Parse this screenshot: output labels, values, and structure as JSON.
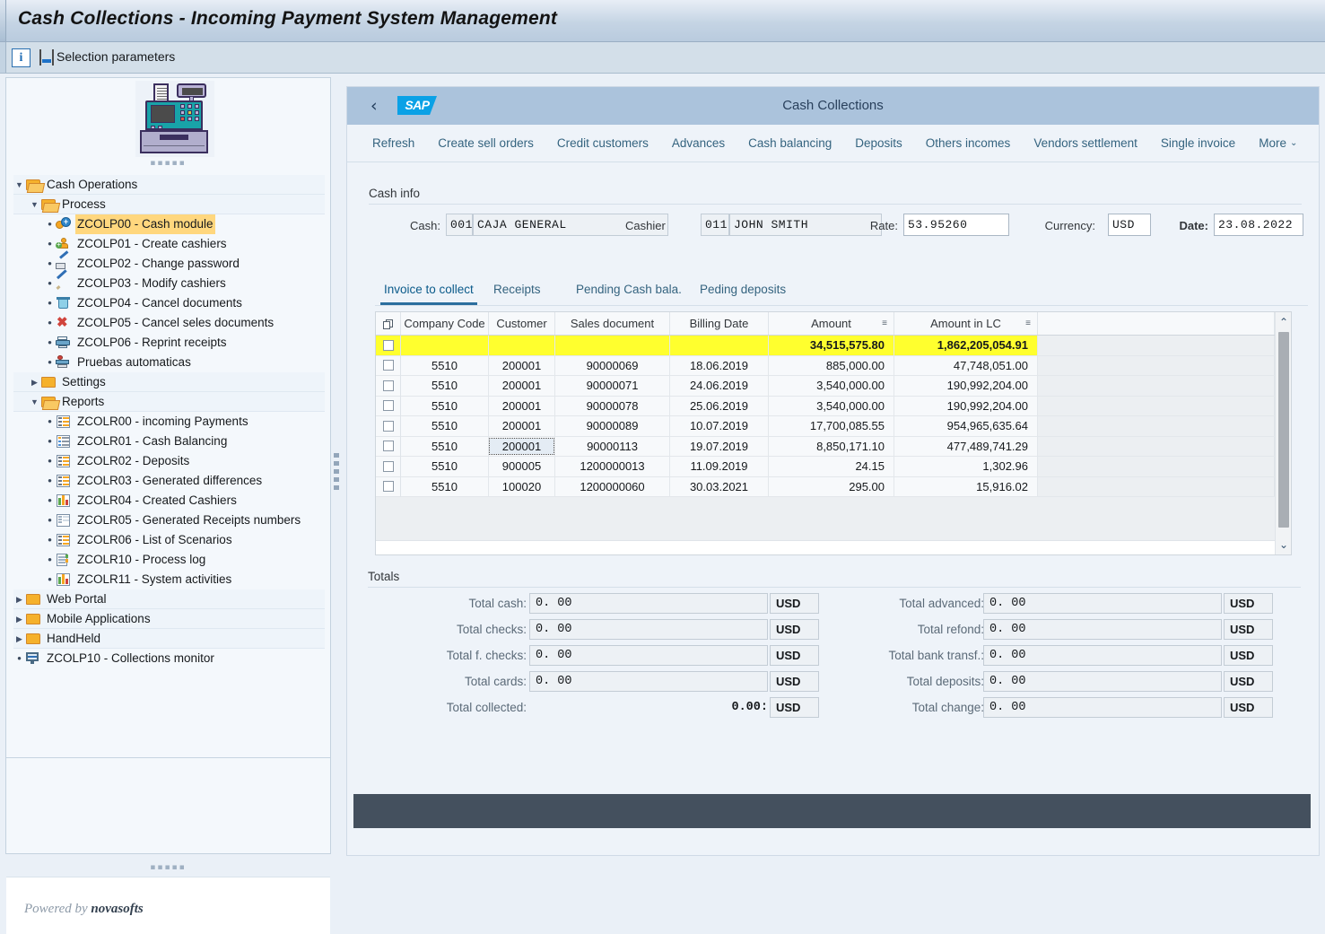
{
  "window": {
    "title": "Cash Collections - Incoming Payment System Management"
  },
  "toolbar": {
    "info_icon": "info-icon",
    "params_icon": "selection-parameters-icon",
    "selection_parameters_label": "Selection parameters"
  },
  "sidebar": {
    "logo_alt": "cash-register-image",
    "powered_prefix": "Powered by ",
    "powered_brand": "novasofts",
    "tree": [
      {
        "label": "Cash Operations",
        "level": 0,
        "kind": "folder-open",
        "expanded": true
      },
      {
        "label": "Process",
        "level": 1,
        "kind": "folder-open",
        "expanded": true
      },
      {
        "label": "ZCOLP00 - Cash module",
        "level": 2,
        "kind": "cash-module",
        "selected": true
      },
      {
        "label": "ZCOLP01 - Create cashiers",
        "level": 2,
        "kind": "create-cashier"
      },
      {
        "label": "ZCOLP02 - Change password",
        "level": 2,
        "kind": "change-password"
      },
      {
        "label": "ZCOLP03 - Modify cashiers",
        "level": 2,
        "kind": "pencil"
      },
      {
        "label": "ZCOLP04 - Cancel documents",
        "level": 2,
        "kind": "trash"
      },
      {
        "label": "ZCOLP05 - Cancel seles documents",
        "level": 2,
        "kind": "red-x"
      },
      {
        "label": "ZCOLP06 - Reprint receipts",
        "level": 2,
        "kind": "printer"
      },
      {
        "label": "Pruebas automaticas",
        "level": 2,
        "kind": "test-machine"
      },
      {
        "label": "Settings",
        "level": 1,
        "kind": "folder-closed",
        "expanded": false
      },
      {
        "label": "Reports",
        "level": 1,
        "kind": "folder-open",
        "expanded": true
      },
      {
        "label": "ZCOLR00 - incoming Payments",
        "level": 2,
        "kind": "report-rows"
      },
      {
        "label": "ZCOLR01 - Cash Balancing",
        "level": 2,
        "kind": "report-list"
      },
      {
        "label": "ZCOLR02 - Deposits",
        "level": 2,
        "kind": "report-rows"
      },
      {
        "label": "ZCOLR03 - Generated differences",
        "level": 2,
        "kind": "report-rows"
      },
      {
        "label": "ZCOLR04 - Created Cashiers",
        "level": 2,
        "kind": "bar-chart"
      },
      {
        "label": "ZCOLR05 - Generated Receipts numbers",
        "level": 2,
        "kind": "report-table"
      },
      {
        "label": "ZCOLR06 - List of Scenarios",
        "level": 2,
        "kind": "report-rows"
      },
      {
        "label": "ZCOLR10 - Process log",
        "level": 2,
        "kind": "log-doc"
      },
      {
        "label": "ZCOLR11 - System activities",
        "level": 2,
        "kind": "bar-chart"
      },
      {
        "label": "Web Portal",
        "level": 0,
        "kind": "folder-closed",
        "expanded": false
      },
      {
        "label": "Mobile Applications",
        "level": 0,
        "kind": "folder-closed",
        "expanded": false
      },
      {
        "label": "HandHeld",
        "level": 0,
        "kind": "folder-closed",
        "expanded": false
      },
      {
        "label": "ZCOLP10 - Collections monitor",
        "level": 0,
        "kind": "monitor"
      }
    ]
  },
  "sap": {
    "back_icon": "back-chevron-icon",
    "logo": "SAP",
    "page_title": "Cash Collections",
    "menu": [
      "Refresh",
      "Create sell orders",
      "Credit customers",
      "Advances",
      "Cash balancing",
      "Deposits",
      "Others incomes",
      "Vendors settlement",
      "Single invoice"
    ],
    "menu_more": "More"
  },
  "cash_info": {
    "section_label": "Cash info",
    "cash_label": "Cash:",
    "cash_code": "001",
    "cash_name": "CAJA GENERAL",
    "cashier_label": "Cashier",
    "cashier_code": "011",
    "cashier_name": "JOHN SMITH",
    "rate_label": "Rate:",
    "rate_value": "53.95260",
    "currency_label": "Currency:",
    "currency_value": "USD",
    "date_label": "Date:",
    "date_value": "23.08.2022"
  },
  "tabs": [
    {
      "label": "Invoice to collect",
      "active": true
    },
    {
      "label": "Receipts",
      "active": false
    },
    {
      "label": "Pending Cash bala.",
      "active": false
    },
    {
      "label": "Peding deposits",
      "active": false
    }
  ],
  "table": {
    "select_all_icon": "multi-select-icon",
    "columns": [
      "Company Code",
      "Customer",
      "Sales document",
      "Billing Date",
      "Amount",
      "Amount in LC"
    ],
    "sort_indicator": "≡",
    "total_row": {
      "amount": "34,515,575.80",
      "amount_lc": "1,862,205,054.91"
    },
    "rows": [
      {
        "company_code": "5510",
        "customer": "200001",
        "sales_document": "90000069",
        "billing_date": "18.06.2019",
        "amount": "885,000.00",
        "amount_lc": "47,748,051.00"
      },
      {
        "company_code": "5510",
        "customer": "200001",
        "sales_document": "90000071",
        "billing_date": "24.06.2019",
        "amount": "3,540,000.00",
        "amount_lc": "190,992,204.00"
      },
      {
        "company_code": "5510",
        "customer": "200001",
        "sales_document": "90000078",
        "billing_date": "25.06.2019",
        "amount": "3,540,000.00",
        "amount_lc": "190,992,204.00"
      },
      {
        "company_code": "5510",
        "customer": "200001",
        "sales_document": "90000089",
        "billing_date": "10.07.2019",
        "amount": "17,700,085.55",
        "amount_lc": "954,965,635.64"
      },
      {
        "company_code": "5510",
        "customer": "200001",
        "sales_document": "90000113",
        "billing_date": "19.07.2019",
        "amount": "8,850,171.10",
        "amount_lc": "477,489,741.29",
        "focused": true
      },
      {
        "company_code": "5510",
        "customer": "900005",
        "sales_document": "1200000013",
        "billing_date": "11.09.2019",
        "amount": "24.15",
        "amount_lc": "1,302.96"
      },
      {
        "company_code": "5510",
        "customer": "100020",
        "sales_document": "1200000060",
        "billing_date": "30.03.2021",
        "amount": "295.00",
        "amount_lc": "15,916.02"
      }
    ]
  },
  "totals": {
    "section_label": "Totals",
    "left": [
      {
        "label": "Total cash:",
        "value": "0. 00",
        "currency": "USD"
      },
      {
        "label": "Total checks:",
        "value": "0. 00",
        "currency": "USD"
      },
      {
        "label": "Total f. checks:",
        "value": "0. 00",
        "currency": "USD"
      },
      {
        "label": "Total cards:",
        "value": "0. 00",
        "currency": "USD"
      }
    ],
    "collected": {
      "label": "Total collected:",
      "value": "0.00:",
      "currency": "USD"
    },
    "right": [
      {
        "label": "Total advanced:",
        "value": "0. 00",
        "currency": "USD"
      },
      {
        "label": "Total refond:",
        "value": "0. 00",
        "currency": "USD"
      },
      {
        "label": "Total bank transf.:",
        "value": "0. 00",
        "currency": "USD"
      },
      {
        "label": "Total deposits:",
        "value": "0. 00",
        "currency": "USD"
      },
      {
        "label": "Total change:",
        "value": "0. 00",
        "currency": "USD"
      }
    ]
  },
  "colors": {
    "title_bar": "#c5d4e4",
    "sap_header": "#abc3dc",
    "sap_logo": "#0aa1e6",
    "tab_active": "#2b6e9e",
    "total_row_highlight": "#ffff2e",
    "tree_selection": "#ffd77e",
    "footer_bar": "#44505e"
  }
}
